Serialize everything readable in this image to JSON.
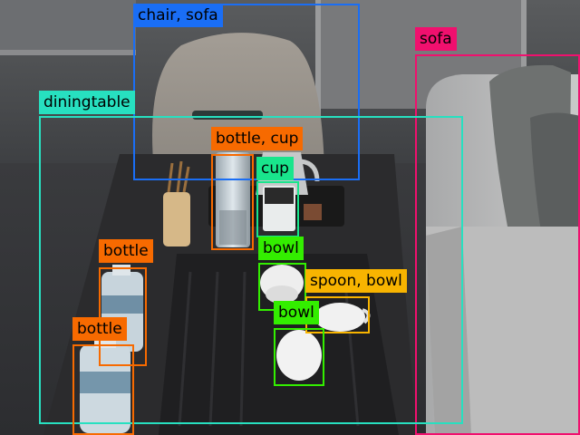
{
  "colors": {
    "chair-sofa": "#1a6ef5",
    "sofa": "#f0106e",
    "diningtable": "#27e0c0",
    "bottle": "#f76a00",
    "cup": "#19e58c",
    "bowl": "#33ee00",
    "spoon-bowl": "#f8b400"
  },
  "detections": [
    {
      "id": "chair-sofa",
      "label": "chair, sofa",
      "color": "chair-sofa",
      "label_color": "#000000"
    },
    {
      "id": "sofa",
      "label": "sofa",
      "color": "sofa",
      "label_color": "#000000"
    },
    {
      "id": "diningtable",
      "label": "diningtable",
      "color": "diningtable",
      "label_color": "#000000"
    },
    {
      "id": "bottle-cup",
      "label": "bottle, cup",
      "color": "bottle",
      "label_color": "#000000"
    },
    {
      "id": "cup",
      "label": "cup",
      "color": "cup",
      "label_color": "#000000"
    },
    {
      "id": "bottle-1",
      "label": "bottle",
      "color": "bottle",
      "label_color": "#000000"
    },
    {
      "id": "bowl-1",
      "label": "bowl",
      "color": "bowl",
      "label_color": "#000000"
    },
    {
      "id": "spoon-bowl",
      "label": "spoon, bowl",
      "color": "spoon-bowl",
      "label_color": "#000000"
    },
    {
      "id": "bowl-2",
      "label": "bowl",
      "color": "bowl",
      "label_color": "#000000"
    },
    {
      "id": "bottle-2",
      "label": "bottle",
      "color": "bottle",
      "label_color": "#000000"
    }
  ]
}
